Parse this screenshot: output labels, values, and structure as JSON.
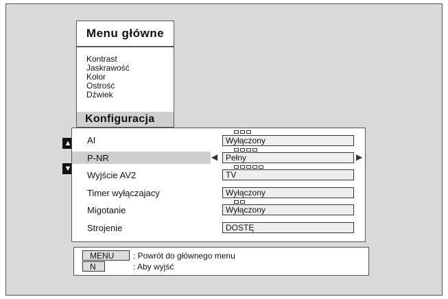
{
  "main_menu": {
    "title": "Menu główne",
    "items": [
      "Kontrast",
      "Jaskrawość",
      "Kolor",
      "Ostrość",
      "Dźwiek"
    ],
    "selected": "Konfiguracja"
  },
  "config": {
    "rows": [
      {
        "label": "AI",
        "value": "Wyłączony",
        "dots": 3
      },
      {
        "label": "P-NR",
        "value": "Pełny",
        "dots": 4
      },
      {
        "label": "Wyjście  AV2",
        "value": "TV",
        "dots": 5
      },
      {
        "label": "Timer  wyłączajacy",
        "value": "Wyłączony",
        "dots": 0
      },
      {
        "label": "Migotanie",
        "value": "Wyłączony",
        "dots": 2
      },
      {
        "label": "Strojenie",
        "value": "DOSTĘ",
        "dots": 0
      }
    ],
    "selected_row": 1
  },
  "help": {
    "menu_key": "MENU",
    "menu_text": ": Powrót do głównego menu",
    "n_key": "N",
    "n_text": ": Aby wyjść"
  }
}
